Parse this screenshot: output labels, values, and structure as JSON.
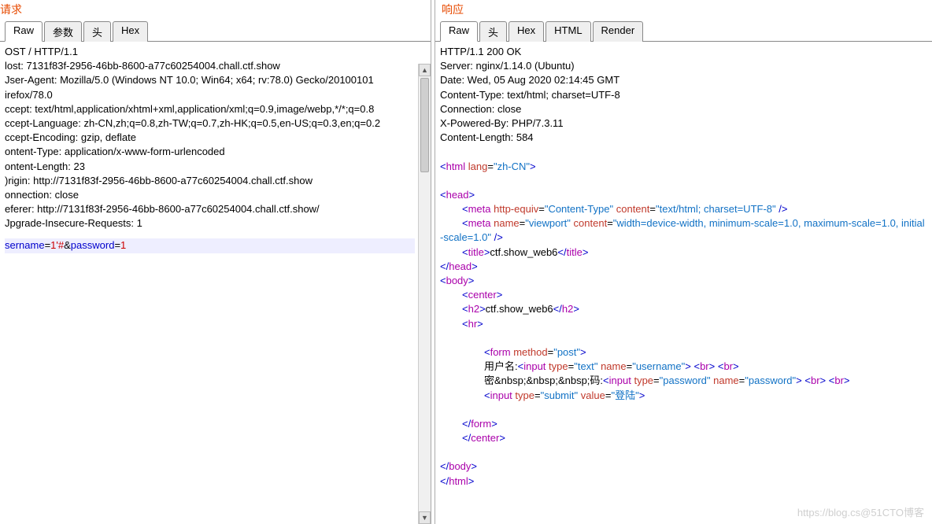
{
  "left": {
    "title": "请求",
    "tabs": [
      "Raw",
      "参数",
      "头",
      "Hex"
    ],
    "active_tab": 0,
    "lines": [
      "OST / HTTP/1.1",
      "lost: 7131f83f-2956-46bb-8600-a77c60254004.chall.ctf.show",
      "Jser-Agent: Mozilla/5.0 (Windows NT 10.0; Win64; x64; rv:78.0) Gecko/20100101",
      "irefox/78.0",
      "ccept: text/html,application/xhtml+xml,application/xml;q=0.9,image/webp,*/*;q=0.8",
      "ccept-Language: zh-CN,zh;q=0.8,zh-TW;q=0.7,zh-HK;q=0.5,en-US;q=0.3,en;q=0.2",
      "ccept-Encoding: gzip, deflate",
      "ontent-Type: application/x-www-form-urlencoded",
      "ontent-Length: 23",
      ")rigin: http://7131f83f-2956-46bb-8600-a77c60254004.chall.ctf.show",
      "onnection: close",
      "eferer: http://7131f83f-2956-46bb-8600-a77c60254004.chall.ctf.show/",
      "Jpgrade-Insecure-Requests: 1"
    ],
    "body_param_user_key": "sername",
    "body_param_user_val": "1'#",
    "body_param_amp": "&",
    "body_param_pass_key": "password",
    "body_param_pass_val": "1"
  },
  "right": {
    "title": "响应",
    "tabs": [
      "Raw",
      "头",
      "Hex",
      "HTML",
      "Render"
    ],
    "active_tab": 0,
    "headers": [
      "HTTP/1.1 200 OK",
      "Server: nginx/1.14.0 (Ubuntu)",
      "Date: Wed, 05 Aug 2020 02:14:45 GMT",
      "Content-Type: text/html; charset=UTF-8",
      "Connection: close",
      "X-Powered-By: PHP/7.3.11",
      "Content-Length: 584"
    ],
    "html_title_text": "ctf.show_web6",
    "h2_text": "ctf.show_web6",
    "label_username": "用户名:",
    "label_password": "密&nbsp;&nbsp;&nbsp;码:",
    "submit_value": "登陆",
    "meta1_equiv": "Content-Type",
    "meta1_content": "text/html; charset=UTF-8",
    "meta2_name": "viewport",
    "meta2_content": "width=device-width, minimum-scale=1.0, maximum-scale=1.0, initial-scale=1.0",
    "lang_val": "zh-CN",
    "form_method": "post",
    "input_user_type": "text",
    "input_user_name": "username",
    "input_pass_type": "password",
    "input_pass_name": "password",
    "input_submit_type": "submit"
  },
  "watermark": "https://blog.cs@51CTO博客"
}
